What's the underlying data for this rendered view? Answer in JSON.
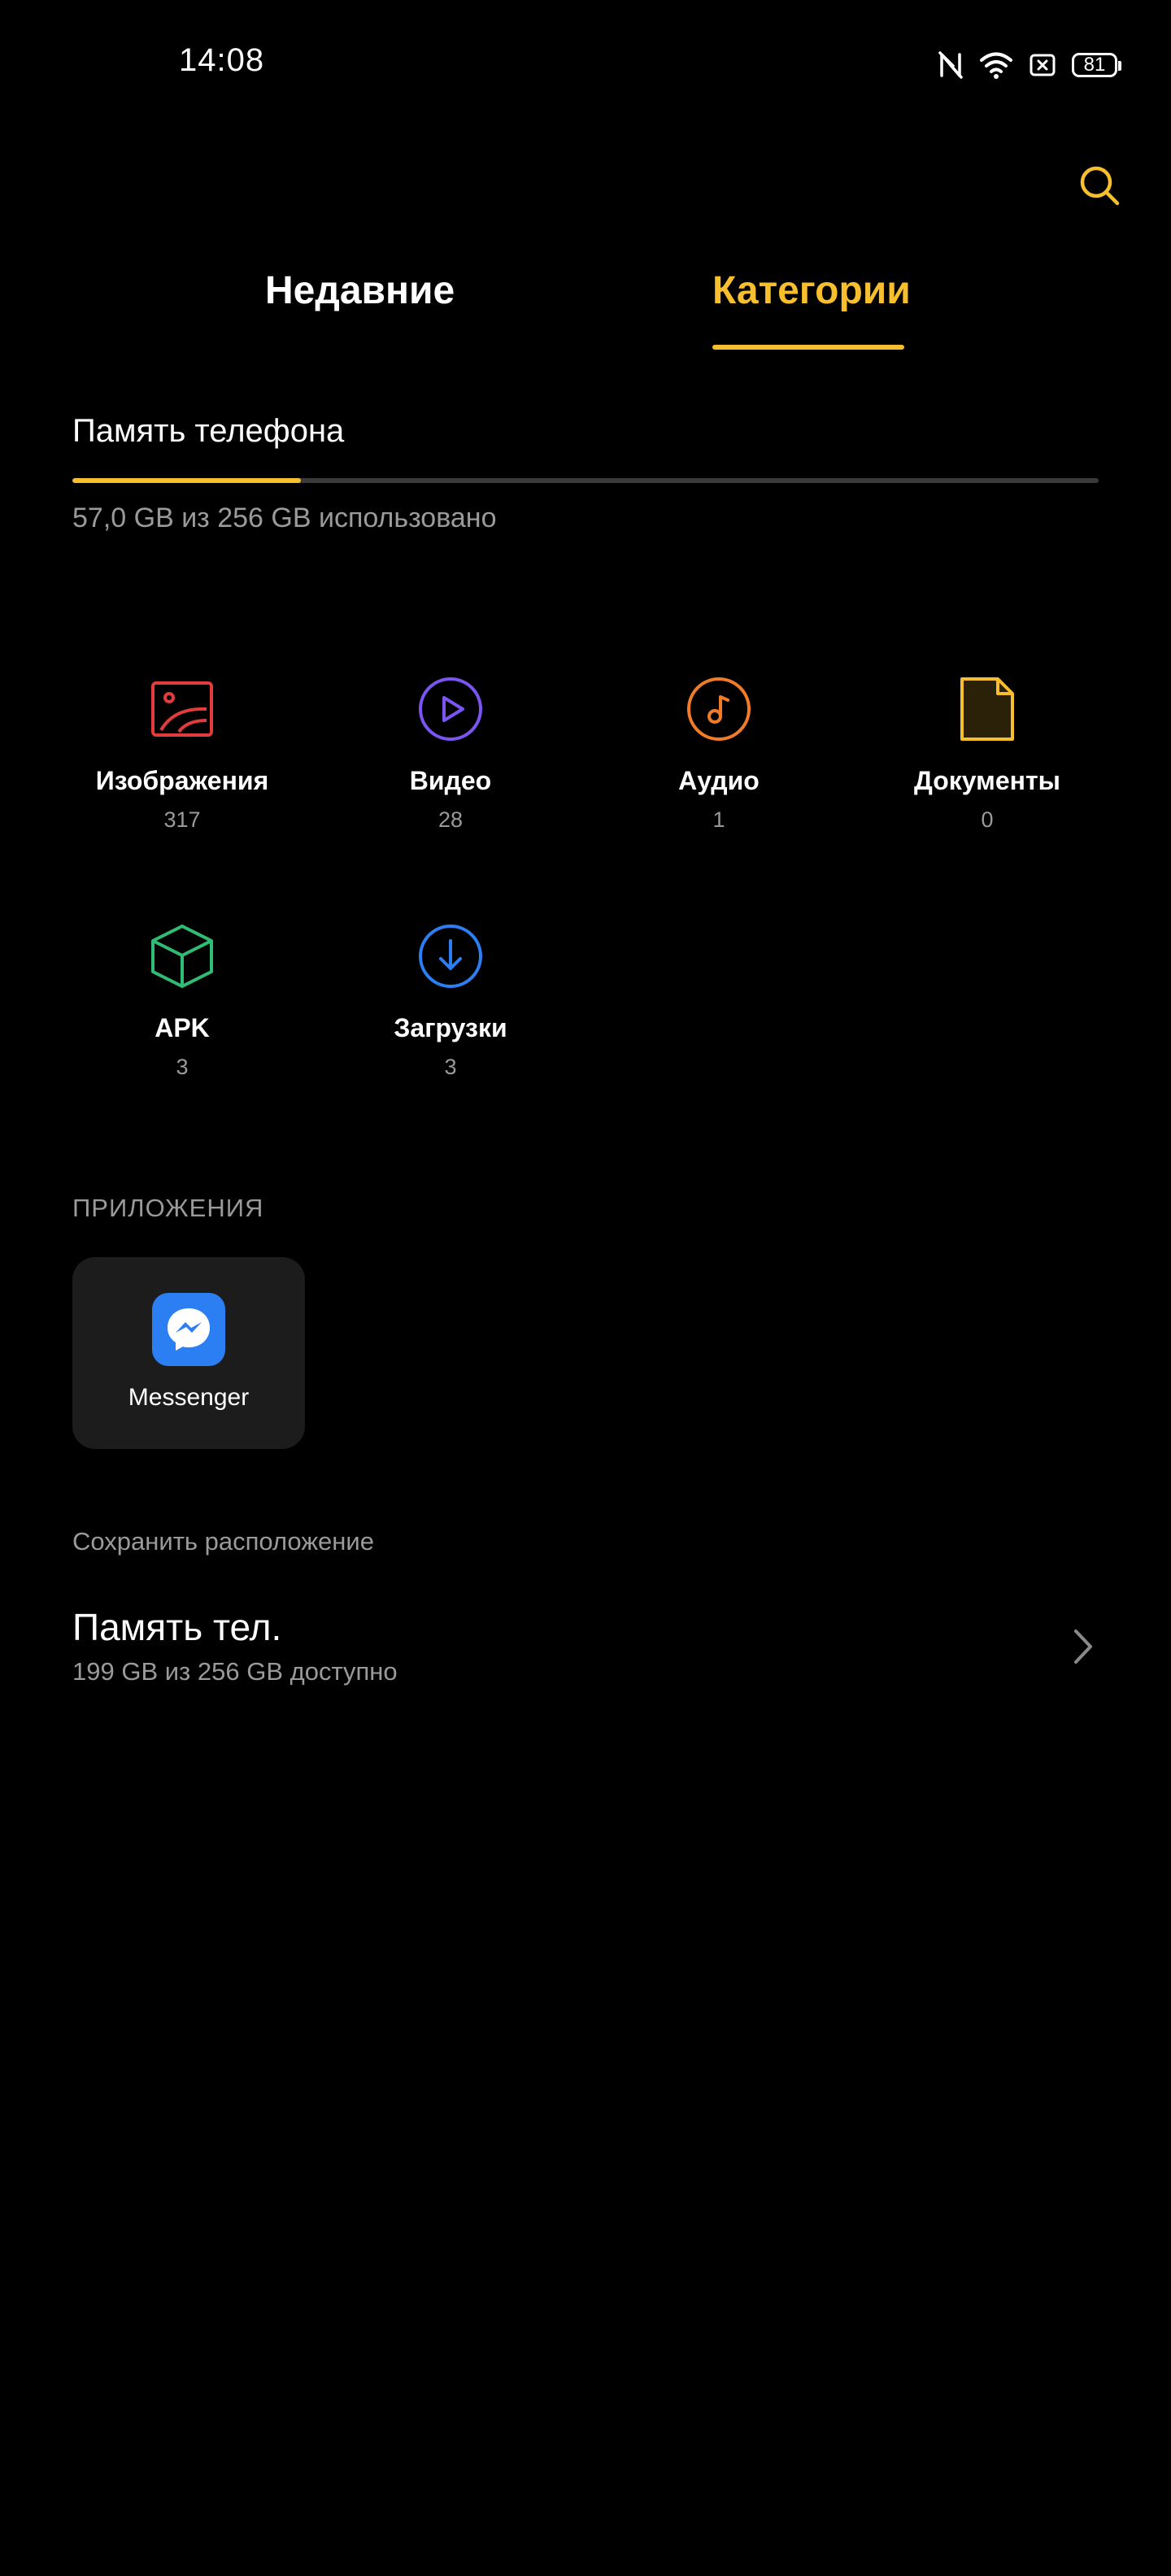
{
  "status_bar": {
    "time": "14:08",
    "battery": "81",
    "icons": [
      "nfc-off-icon",
      "wifi-icon",
      "sim-off-icon",
      "battery-icon"
    ]
  },
  "header": {
    "search_icon": "search-icon"
  },
  "tabs": [
    {
      "label": "Недавние",
      "active": false
    },
    {
      "label": "Категории",
      "active": true
    }
  ],
  "storage": {
    "title": "Память телефона",
    "usage_text": "57,0 GB из 256 GB использовано",
    "used_fraction": 0.2227
  },
  "categories": [
    {
      "label": "Изображения",
      "count": "317",
      "icon": "image-icon",
      "color": "#e23b3b"
    },
    {
      "label": "Видео",
      "count": "28",
      "icon": "play-circle-icon",
      "color": "#7b55f2"
    },
    {
      "label": "Аудио",
      "count": "1",
      "icon": "music-note-icon",
      "color": "#f07c2a"
    },
    {
      "label": "Документы",
      "count": "0",
      "icon": "document-icon",
      "color": "#f7be2d"
    },
    {
      "label": "APK",
      "count": "3",
      "icon": "package-cube-icon",
      "color": "#2ebd73"
    },
    {
      "label": "Загрузки",
      "count": "3",
      "icon": "download-icon",
      "color": "#2c7ff2"
    }
  ],
  "apps": {
    "heading": "ПРИЛОЖЕНИЯ",
    "items": [
      {
        "label": "Messenger",
        "icon": "messenger-icon",
        "color": "#2c7ff2"
      }
    ]
  },
  "save_location": {
    "heading": "Сохранить расположение",
    "title": "Память тел.",
    "subtitle": "199 GB из 256 GB доступно"
  },
  "colors": {
    "accent": "#f7be2d",
    "background": "#000000",
    "secondary_text": "#9a9a9a"
  }
}
